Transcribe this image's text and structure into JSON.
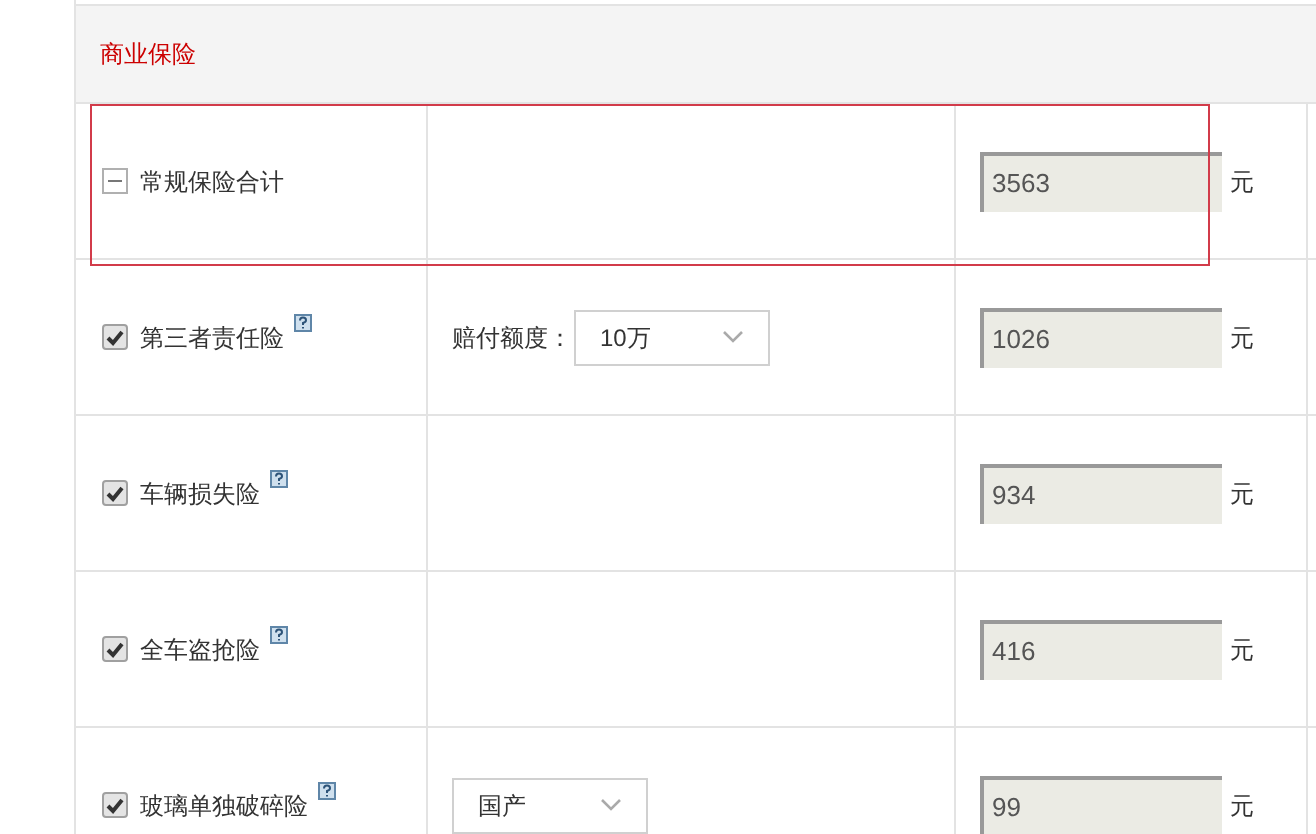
{
  "section": {
    "title": "商业保险"
  },
  "rows": [
    {
      "kind": "total",
      "expanded": true,
      "highlighted": true,
      "name": "常规保险合计",
      "amount": "3563",
      "unit": "元"
    },
    {
      "kind": "item",
      "checked": true,
      "highlighted": false,
      "name": "第三者责任险",
      "option": {
        "label": "赔付额度：",
        "value": "10万"
      },
      "amount": "1026",
      "unit": "元"
    },
    {
      "kind": "item",
      "checked": true,
      "highlighted": false,
      "name": "车辆损失险",
      "amount": "934",
      "unit": "元"
    },
    {
      "kind": "item",
      "checked": true,
      "highlighted": false,
      "name": "全车盗抢险",
      "amount": "416",
      "unit": "元"
    },
    {
      "kind": "item",
      "checked": true,
      "highlighted": false,
      "name": "玻璃单独破碎险",
      "option": {
        "value": "国产"
      },
      "amount": "99",
      "unit": "元"
    }
  ]
}
